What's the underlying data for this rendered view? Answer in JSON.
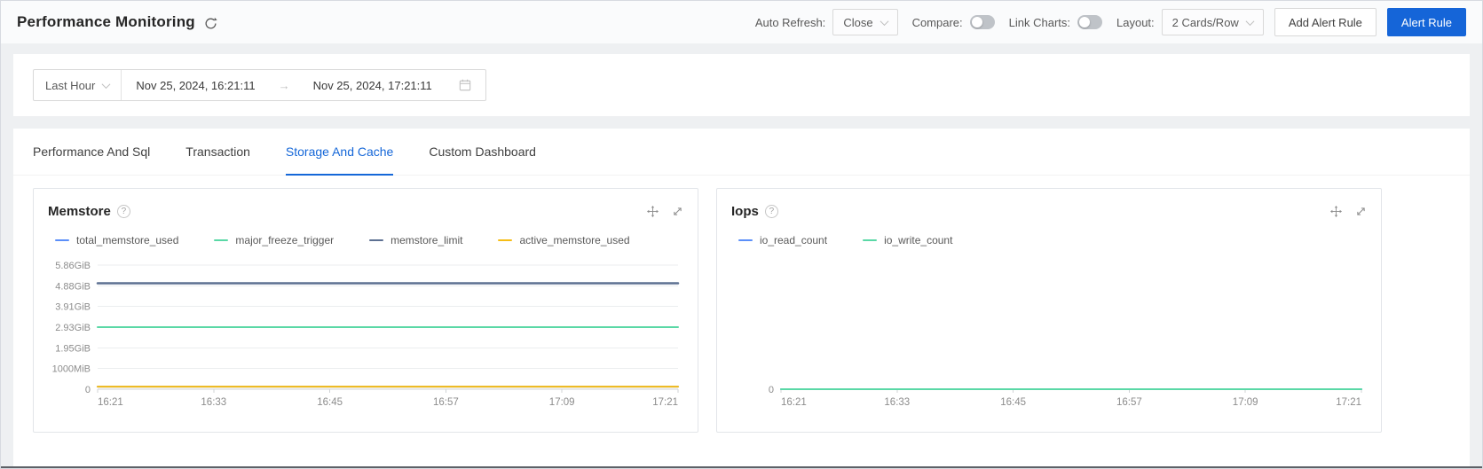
{
  "header": {
    "title": "Performance Monitoring",
    "auto_refresh_label": "Auto Refresh:",
    "auto_refresh_value": "Close",
    "compare_label": "Compare:",
    "link_charts_label": "Link Charts:",
    "layout_label": "Layout:",
    "layout_value": "2 Cards/Row",
    "add_alert_rule_label": "Add Alert Rule",
    "alert_rule_label": "Alert Rule"
  },
  "time_bar": {
    "preset": "Last Hour",
    "start": "Nov 25, 2024, 16:21:11",
    "end": "Nov 25, 2024, 17:21:11",
    "range_arrow": "→"
  },
  "tabs": [
    {
      "label": "Performance And Sql",
      "active": false
    },
    {
      "label": "Transaction",
      "active": false
    },
    {
      "label": "Storage And Cache",
      "active": true
    },
    {
      "label": "Custom Dashboard",
      "active": false
    }
  ],
  "icons": {
    "help_glyph": "?",
    "refresh": "circular-sync-arrow",
    "move": "drag-cross-arrows",
    "fullscreen": "expand-diagonal-arrows",
    "calendar": "calendar",
    "chevron": "chevron-down"
  },
  "colors": {
    "accent_blue": "#1565d8",
    "series_blue": "#5B8FF9",
    "series_green": "#5AD8A6",
    "series_dark": "#5D7092",
    "series_yellow": "#F6BD16",
    "toggle_off": "#bfc3c8"
  },
  "chart_data": [
    {
      "type": "line",
      "title": "Memstore",
      "x": [
        "16:21",
        "16:33",
        "16:45",
        "16:57",
        "17:09",
        "17:21"
      ],
      "y_tick_labels": [
        "0",
        "1000MiB",
        "1.95GiB",
        "2.93GiB",
        "3.91GiB",
        "4.88GiB",
        "5.86GiB"
      ],
      "y_axis_max": 5.86,
      "y_unit": "GiB",
      "grid": true,
      "legend_position": "top",
      "note": "all series are flat/constant over the hour",
      "series": [
        {
          "name": "total_memstore_used",
          "color": "#5B8FF9",
          "value": 0.12
        },
        {
          "name": "major_freeze_trigger",
          "color": "#5AD8A6",
          "value": 2.93
        },
        {
          "name": "memstore_limit",
          "color": "#5D7092",
          "value": 5.0
        },
        {
          "name": "active_memstore_used",
          "color": "#F6BD16",
          "value": 0.12
        }
      ]
    },
    {
      "type": "line",
      "title": "Iops",
      "x": [
        "16:21",
        "16:33",
        "16:45",
        "16:57",
        "17:09",
        "17:21"
      ],
      "y_tick_labels": [
        "0"
      ],
      "y_axis_max": 1,
      "y_unit": "count",
      "grid": false,
      "legend_position": "top",
      "note": "both series flat at zero",
      "series": [
        {
          "name": "io_read_count",
          "color": "#5B8FF9",
          "value": 0
        },
        {
          "name": "io_write_count",
          "color": "#5AD8A6",
          "value": 0
        }
      ]
    }
  ]
}
